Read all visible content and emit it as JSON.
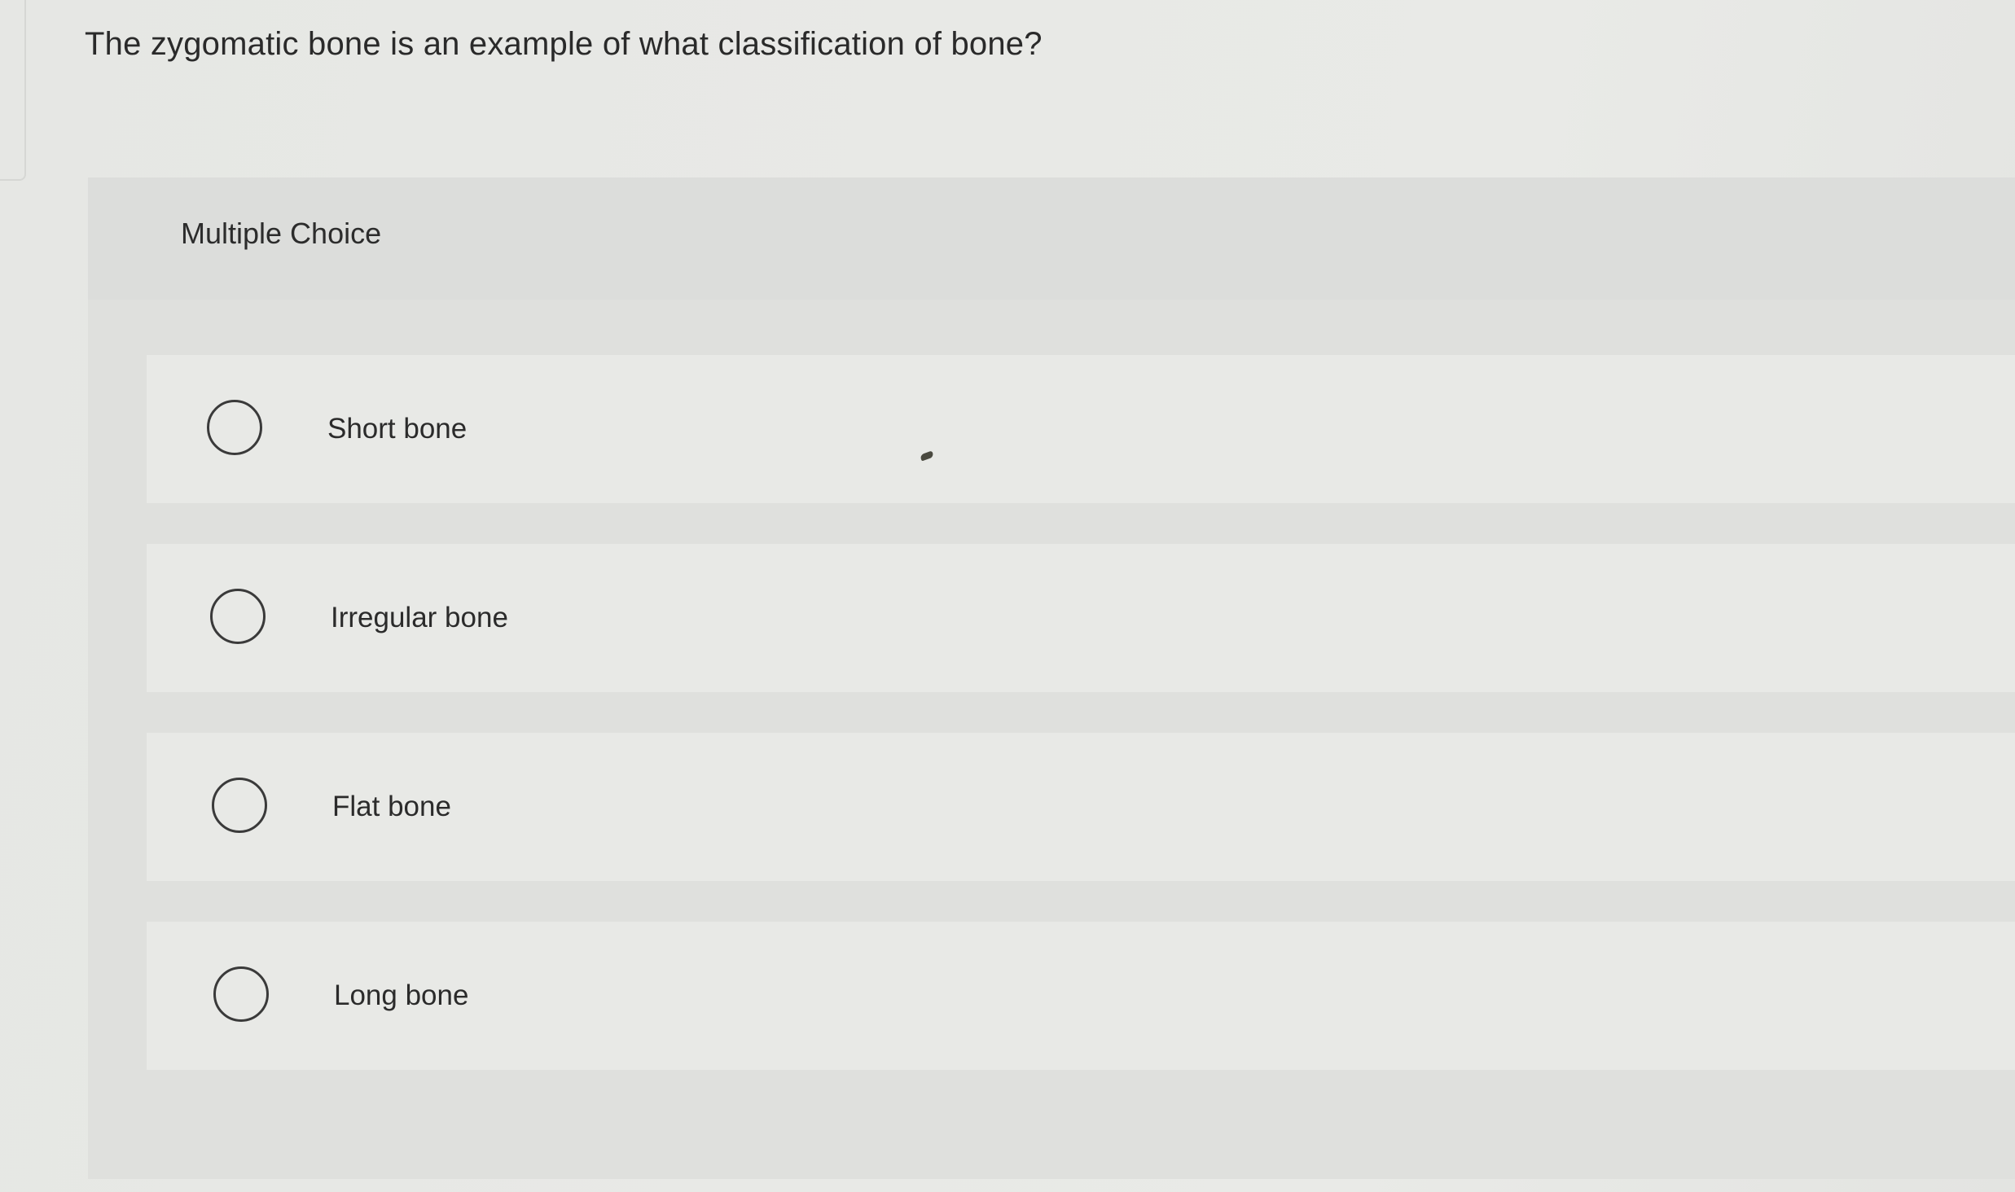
{
  "question": {
    "text": "The zygomatic bone is an example of what classification of bone?"
  },
  "multiple_choice": {
    "label": "Multiple Choice",
    "options": [
      {
        "label": "Short bone",
        "selected": false
      },
      {
        "label": "Irregular bone",
        "selected": false
      },
      {
        "label": "Flat bone",
        "selected": false
      },
      {
        "label": "Long bone",
        "selected": false
      }
    ]
  },
  "colors": {
    "background": "#e6e7e4",
    "panel": "#dfe0dd",
    "option_row": "#e8e9e6",
    "text": "#2b2b2b"
  }
}
